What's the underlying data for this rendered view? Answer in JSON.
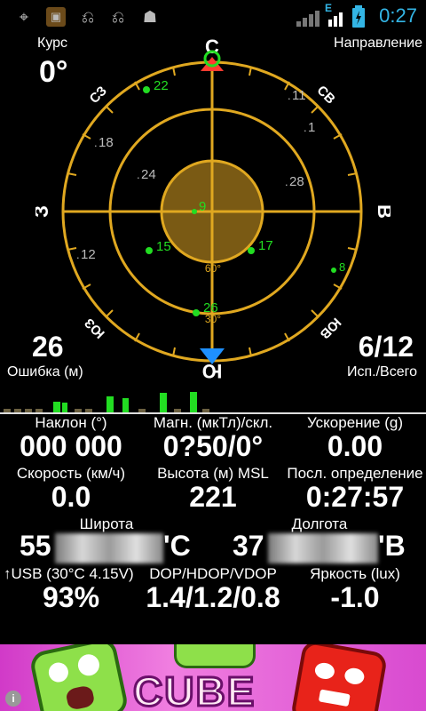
{
  "status": {
    "time": "0:27",
    "network": "E"
  },
  "compass": {
    "course_label": "Курс",
    "course_value": "0°",
    "direction_label": "Направление",
    "cardinals": {
      "n": "С",
      "s": "Ю",
      "e": "В",
      "w": "З",
      "ne": "СВ",
      "nw": "СЗ",
      "se": "ЮВ",
      "sw": "ЮЗ"
    },
    "ring_labels": {
      "r60": "60°",
      "r30": "30°"
    },
    "error_value": "26",
    "error_label": "Ошибка (м)",
    "sats_value": "6/12",
    "sats_label": "Исп./Всего",
    "satellites": [
      {
        "id": "22",
        "used": true
      },
      {
        "id": "11",
        "used": false
      },
      {
        "id": "1",
        "used": false
      },
      {
        "id": "18",
        "used": false
      },
      {
        "id": "24",
        "used": false
      },
      {
        "id": "28",
        "used": false
      },
      {
        "id": "9",
        "used": true
      },
      {
        "id": "15",
        "used": true
      },
      {
        "id": "17",
        "used": true
      },
      {
        "id": "12",
        "used": false
      },
      {
        "id": "8",
        "used": true
      },
      {
        "id": "26",
        "used": true
      }
    ]
  },
  "data": {
    "tilt_label": "Наклон (°)",
    "tilt_value": "000 000",
    "mag_label": "Магн. (мкТл)/скл.",
    "mag_value": "0?50/0°",
    "accel_label": "Ускорение (g)",
    "accel_value": "0.00",
    "speed_label": "Скорость (км/ч)",
    "speed_value": "0.0",
    "alt_label": "Высота (м) MSL",
    "alt_value": "221",
    "last_label": "Посл. определение",
    "last_value": "0:27:57",
    "lat_label": "Широта",
    "lat_prefix": "55",
    "lat_suffix": "'С",
    "lon_label": "Долгота",
    "lon_prefix": "37",
    "lon_suffix": "'В",
    "battery_label": "↑USB (30°C 4.15V)",
    "battery_value": "93%",
    "dop_label": "DOP/HDOP/VDOP",
    "dop_value": "1.4/1.2/0.8",
    "bright_label": "Яркость (lux)",
    "bright_value": "-1.0"
  },
  "ad": {
    "text": "CUBE",
    "info": "i"
  },
  "colors": {
    "ring": "#e0a820",
    "used_sat": "#22dd22",
    "arrow_red": "#ff3b30",
    "arrow_blue": "#1e90ff",
    "clock": "#33b5e5"
  }
}
